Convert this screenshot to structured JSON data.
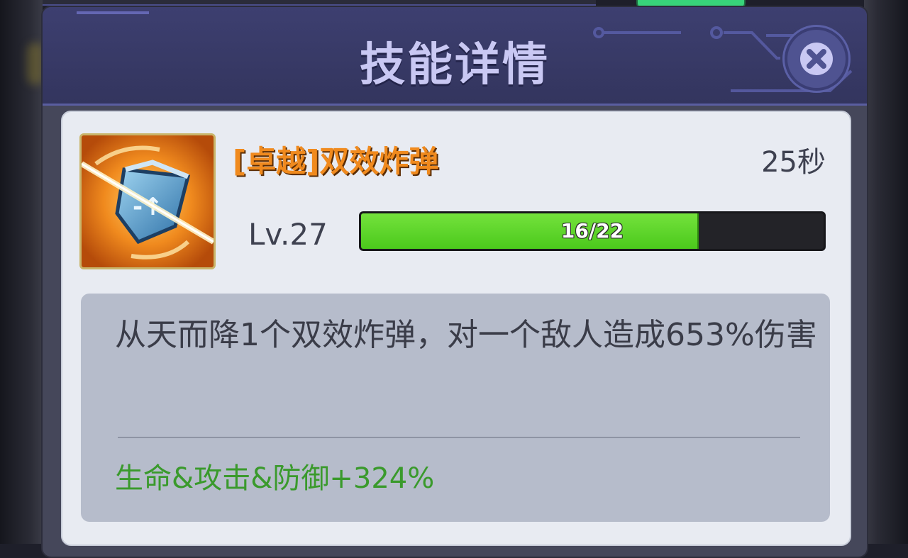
{
  "dialog": {
    "title": "技能详情",
    "close_icon": "close-x-icon"
  },
  "skill": {
    "icon": "shield-bomb-icon",
    "name": "[卓越]双效炸弹",
    "cooldown": "25秒",
    "level": "Lv.27",
    "progress": {
      "text": "16/22",
      "current": 16,
      "max": 22
    },
    "description": "从天而降1个双效炸弹，对一个敌人造成653%伤害",
    "bonus": "生命&攻击&防御+324%"
  },
  "colors": {
    "name": "#f08a1e",
    "progress_fill": "#5fd22a",
    "bonus": "#3a9a2c",
    "header": "#3d3f70"
  }
}
